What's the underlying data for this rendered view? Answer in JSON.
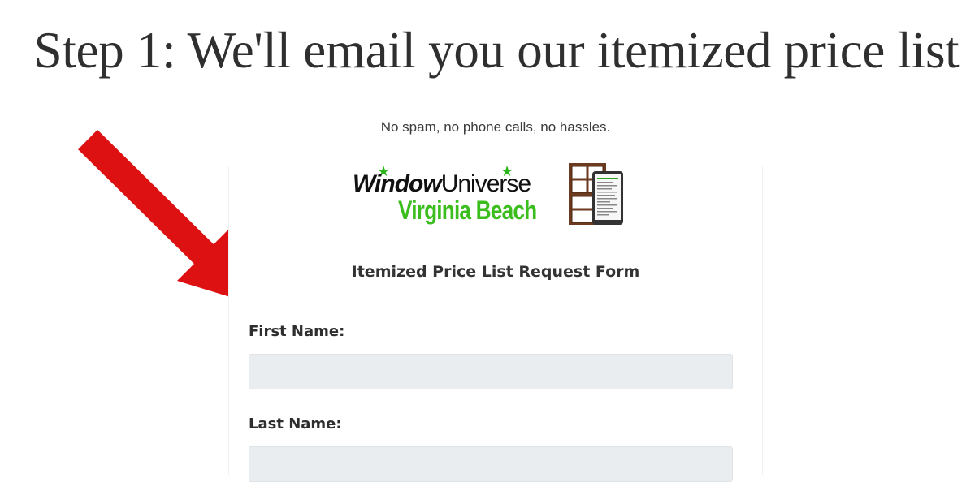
{
  "heading": "Step 1: We'll email you our itemized price list",
  "subtitle": "No spam, no phone calls, no hassles.",
  "logo": {
    "word1": "Window",
    "word2": "Universe",
    "line2": "Virginia Beach"
  },
  "form": {
    "title": "Itemized Price List Request Form",
    "fields": [
      {
        "label": "First Name:",
        "value": ""
      },
      {
        "label": "Last Name:",
        "value": ""
      }
    ]
  },
  "colors": {
    "arrow": "#dd1111",
    "logo_green": "#3bbd1e",
    "input_bg": "#e9edef"
  }
}
